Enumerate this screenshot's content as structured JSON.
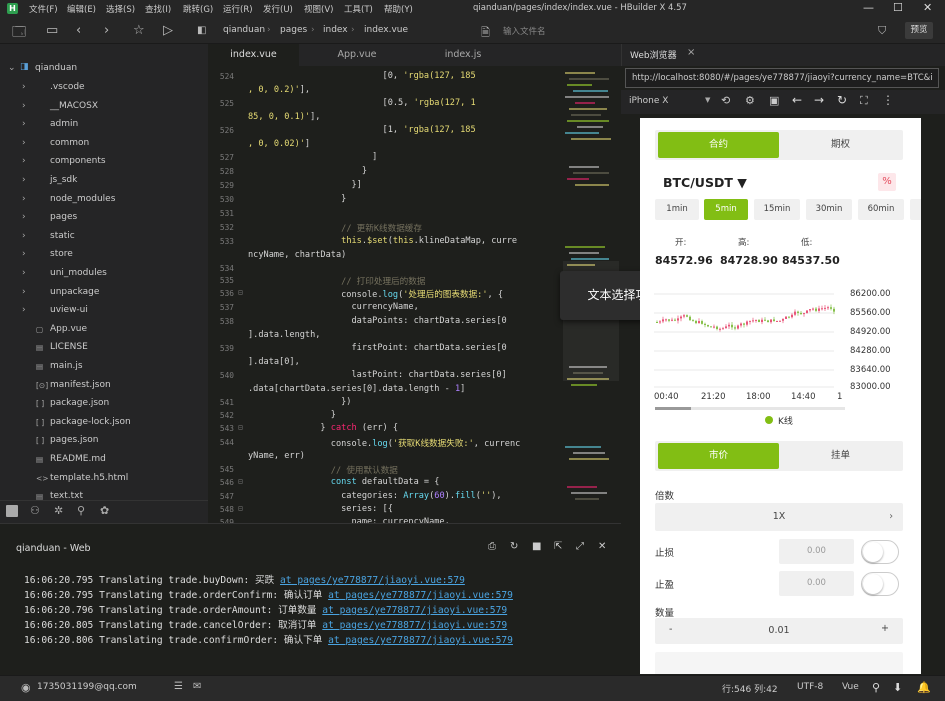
{
  "title_bar": {
    "title": "qianduan/pages/index/index.vue - HBuilder X 4.57",
    "menus": [
      "文件(F)",
      "编辑(E)",
      "选择(S)",
      "查找(I)",
      "跳转(G)",
      "运行(R)",
      "发行(U)",
      "视图(V)",
      "工具(T)",
      "帮助(Y)"
    ]
  },
  "toolbar": {
    "breadcrumbs": [
      "qianduan",
      "pages",
      "index",
      "index.vue"
    ],
    "search_placeholder": "输入文件名",
    "preview_label": "预览"
  },
  "sidebar": {
    "root": "qianduan",
    "items": [
      {
        "label": ".vscode",
        "type": "folder"
      },
      {
        "label": "__MACOSX",
        "type": "folder"
      },
      {
        "label": "admin",
        "type": "folder"
      },
      {
        "label": "common",
        "type": "folder"
      },
      {
        "label": "components",
        "type": "folder"
      },
      {
        "label": "js_sdk",
        "type": "folder"
      },
      {
        "label": "node_modules",
        "type": "folder"
      },
      {
        "label": "pages",
        "type": "folder"
      },
      {
        "label": "static",
        "type": "folder"
      },
      {
        "label": "store",
        "type": "folder"
      },
      {
        "label": "uni_modules",
        "type": "folder"
      },
      {
        "label": "unpackage",
        "type": "folder"
      },
      {
        "label": "uview-ui",
        "type": "folder"
      },
      {
        "label": "App.vue",
        "type": "vue"
      },
      {
        "label": "LICENSE",
        "type": "file"
      },
      {
        "label": "main.js",
        "type": "file"
      },
      {
        "label": "manifest.json",
        "type": "manifest"
      },
      {
        "label": "package.json",
        "type": "json"
      },
      {
        "label": "package-lock.json",
        "type": "json"
      },
      {
        "label": "pages.json",
        "type": "json"
      },
      {
        "label": "README.md",
        "type": "file"
      },
      {
        "label": "template.h5.html",
        "type": "html"
      },
      {
        "label": "text.txt",
        "type": "file"
      }
    ]
  },
  "editor": {
    "tabs": [
      "index.vue",
      "App.vue",
      "index.js"
    ],
    "active_tab": "index.vue"
  },
  "tooltip": "文本选择功能已禁用",
  "web_panel": {
    "tab_label": "Web浏览器",
    "url": "http://localhost:8080/#/pages/ye778877/jiaoyi?currency_name=BTC&i",
    "device": "iPhone X",
    "app": {
      "top_tabs": [
        "合约",
        "期权"
      ],
      "pair": "BTC/USDT ▼",
      "percent_icon": "%",
      "intervals": [
        "1min",
        "5min",
        "15min",
        "30min",
        "60min"
      ],
      "active_interval": "5min",
      "stats": [
        {
          "label": "开:",
          "value": "84572.96"
        },
        {
          "label": "高:",
          "value": "84728.90"
        },
        {
          "label": "低:",
          "value": "84537.50"
        }
      ],
      "y_ticks": [
        "86200.00",
        "85560.00",
        "84920.00",
        "84280.00",
        "83640.00",
        "83000.00"
      ],
      "x_ticks": [
        "00:40",
        "21:20",
        "18:00",
        "14:40",
        "1"
      ],
      "legend": "K线",
      "order_tabs": [
        "市价",
        "挂单"
      ],
      "multiplier_label": "倍数",
      "multiplier_value": "1X",
      "stop_loss_label": "止损",
      "stop_loss_value": "0.00",
      "take_profit_label": "止盈",
      "take_profit_value": "0.00",
      "qty_label": "数量",
      "qty_minus": "-",
      "qty_value": "0.01",
      "qty_plus": "+"
    }
  },
  "console": {
    "title": "qianduan - Web",
    "lines": [
      {
        "text": "16:06:20.795 Translating trade.buyDown: 买跌 ",
        "link": "at pages/ye778877/jiaoyi.vue:579"
      },
      {
        "text": "16:06:20.795 Translating trade.orderConfirm: 确认订单 ",
        "link": "at pages/ye778877/jiaoyi.vue:579"
      },
      {
        "text": "16:06:20.796 Translating trade.orderAmount: 订单数量 ",
        "link": "at pages/ye778877/jiaoyi.vue:579"
      },
      {
        "text": "16:06:20.805 Translating trade.cancelOrder: 取消订单 ",
        "link": "at pages/ye778877/jiaoyi.vue:579"
      },
      {
        "text": "16:06:20.806 Translating trade.confirmOrder: 确认下单 ",
        "link": "at pages/ye778877/jiaoyi.vue:579"
      }
    ]
  },
  "status_bar": {
    "user": "1735031199@qq.com",
    "position": "行:546  列:42",
    "encoding": "UTF-8",
    "language": "Vue"
  }
}
